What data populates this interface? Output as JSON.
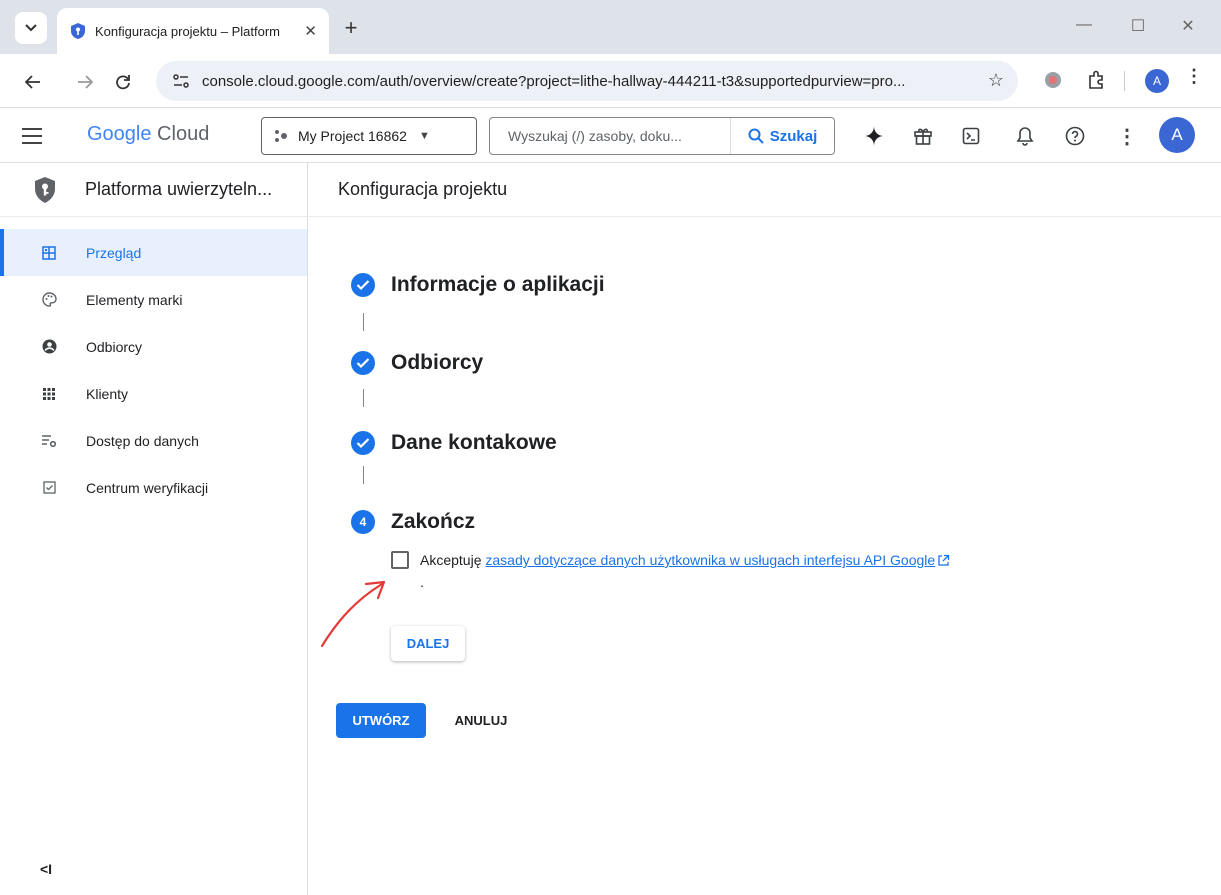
{
  "browser": {
    "tab_title": "Konfiguracja projektu – Platform",
    "url": "console.cloud.google.com/auth/overview/create?project=lithe-hallway-444211-t3&supportedpurview=pro...",
    "profile_initial": "A"
  },
  "topbar": {
    "logo_google": "Google",
    "logo_cloud": " Cloud",
    "project_name": "My Project 16862",
    "search_placeholder": "Wyszukaj (/) zasoby, doku...",
    "search_button": "Szukaj",
    "avatar_initial": "A"
  },
  "sidebar": {
    "title": "Platforma uwierzyteln...",
    "items": [
      {
        "label": "Przegląd",
        "icon": "dashboard-icon",
        "active": true
      },
      {
        "label": "Elementy marki",
        "icon": "palette-icon",
        "active": false
      },
      {
        "label": "Odbiorcy",
        "icon": "account-circle-icon",
        "active": false
      },
      {
        "label": "Klienty",
        "icon": "apps-grid-icon",
        "active": false
      },
      {
        "label": "Dostęp do danych",
        "icon": "data-settings-icon",
        "active": false
      },
      {
        "label": "Centrum weryfikacji",
        "icon": "checkbox-icon",
        "active": false
      }
    ],
    "collapse_label": "<I"
  },
  "main": {
    "header": "Konfiguracja projektu",
    "steps": [
      {
        "title": "Informacje o aplikacji",
        "status": "done"
      },
      {
        "title": "Odbiorcy",
        "status": "done"
      },
      {
        "title": "Dane kontakowe",
        "status": "done"
      },
      {
        "title": "Zakończ",
        "status": "current",
        "number": "4"
      }
    ],
    "consent_prefix": "Akceptuję ",
    "consent_link": "zasady dotyczące danych użytkownika w usługach interfejsu API Google",
    "consent_suffix": ".",
    "next_button": "DALEJ",
    "create_button": "UTWÓRZ",
    "cancel_button": "ANULUJ"
  },
  "colors": {
    "accent": "#1a73e8",
    "active_bg": "#e8f0fe",
    "annotation": "#e53935"
  }
}
